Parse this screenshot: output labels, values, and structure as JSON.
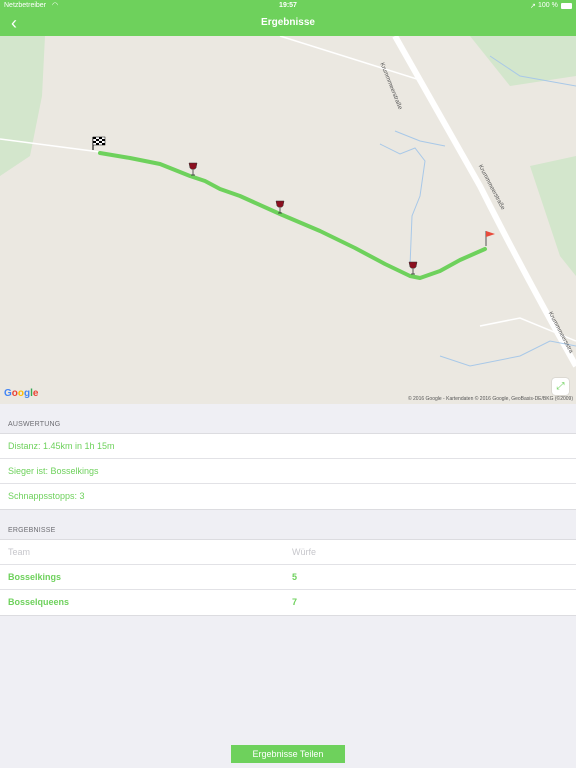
{
  "statusbar": {
    "carrier": "Netzbetreiber",
    "time": "19:57",
    "battery": "100 %"
  },
  "navbar": {
    "title": "Ergebnisse",
    "back_icon": "chevron-left-icon"
  },
  "map": {
    "google_letters": [
      "G",
      "o",
      "o",
      "g",
      "l",
      "e"
    ],
    "attribution": "© 2016 Google - Kartendaten © 2016 Google, GeoBasis-DE/BKG (©2009)",
    "street_label_1": "Krummmeerstraße",
    "street_label_2": "Krummmeerstraße",
    "street_label_3": "Krummmeersstra",
    "route_color": "#6ed15c",
    "water_color": "#a8c8e8",
    "park_color": "#c9e0c4"
  },
  "auswertung": {
    "header": "AUSWERTUNG",
    "rows": [
      "Distanz: 1.45km in 1h 15m",
      "Sieger ist: Bosselkings",
      "Schnappsstopps: 3"
    ]
  },
  "ergebnisse": {
    "header": "ERGEBNISSE",
    "columns": [
      "Team",
      "Würfe"
    ],
    "rows": [
      {
        "team": "Bosselkings",
        "wuerfe": "5"
      },
      {
        "team": "Bosselqueens",
        "wuerfe": "7"
      }
    ]
  },
  "share_button": "Ergebnisse Teilen",
  "accent_color": "#6ed15c"
}
